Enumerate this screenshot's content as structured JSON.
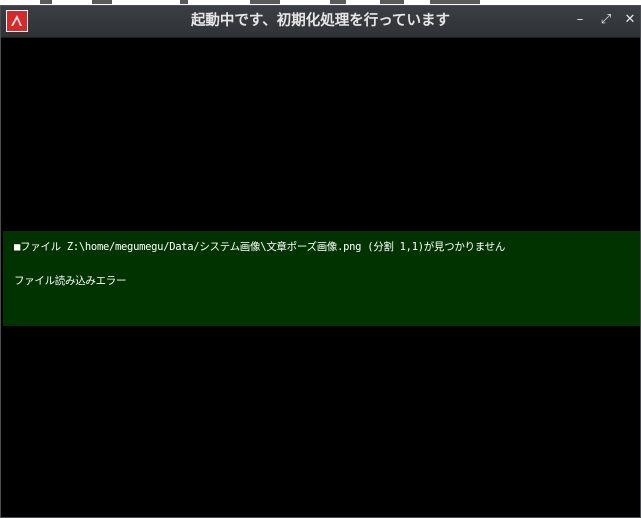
{
  "window": {
    "title": "起動中です、初期化処理を行っています",
    "app_icon": "app-logo-icon",
    "controls": {
      "minimize": "–",
      "maximize": "⤢",
      "close": "✕"
    },
    "colors": {
      "titlebar": "#34373c",
      "content_bg": "#000000",
      "panel_bg": "#003300",
      "text": "#ffffff"
    }
  },
  "error_panel": {
    "message": "■ファイル Z:\\home/megumegu/Data/システム画像\\文章ポーズ画像.png (分割 1,1)が見つかりません",
    "detail": "ファイル読み込みエラー"
  }
}
